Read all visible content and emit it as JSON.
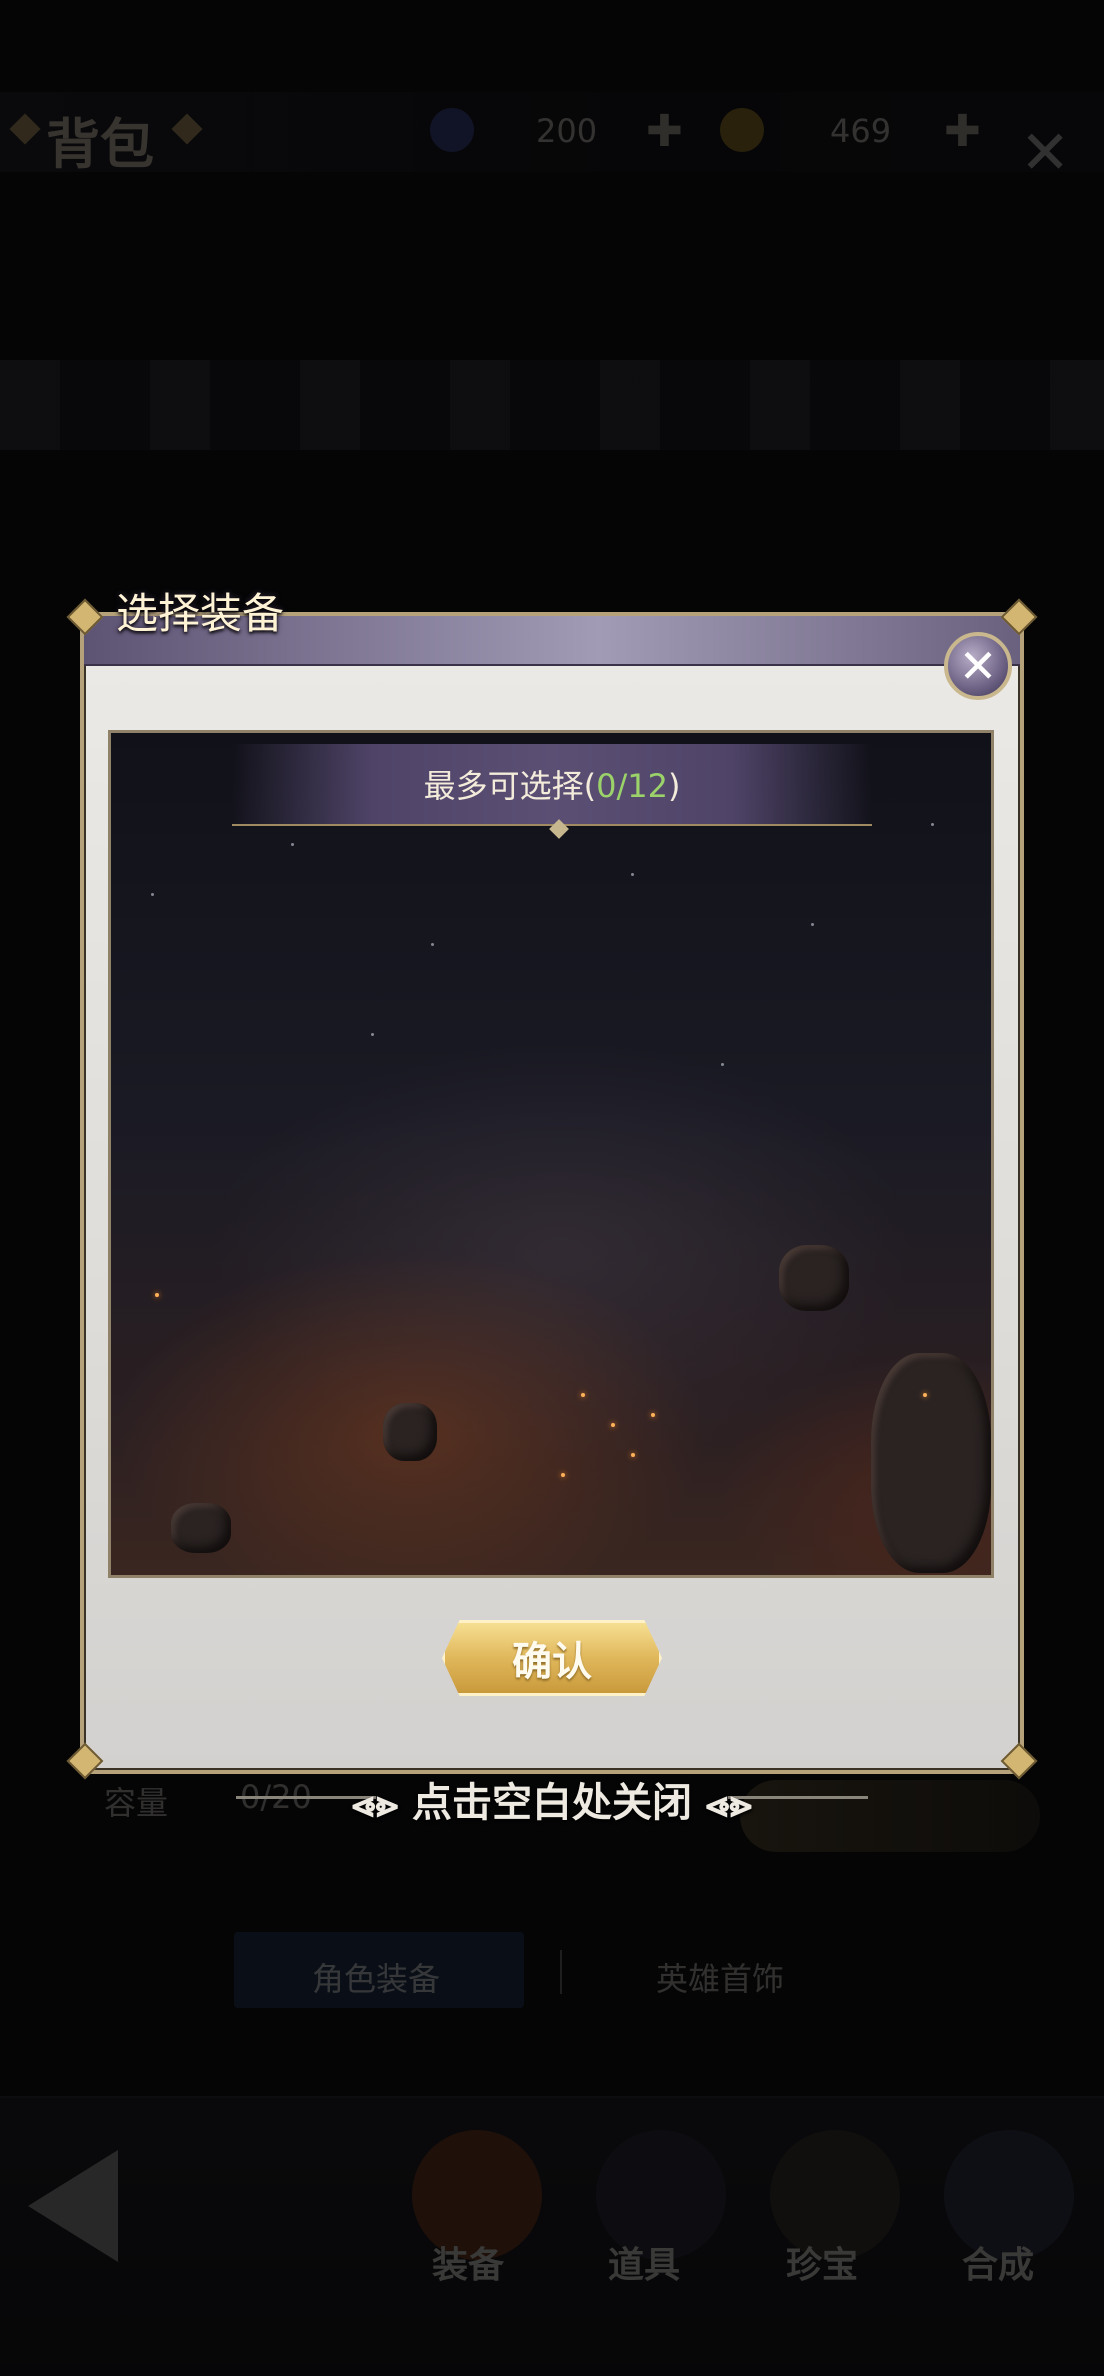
{
  "background": {
    "bag_title": "背包",
    "resource_1_value": "200",
    "resource_2_value": "469",
    "capacity_label": "容量",
    "capacity_value": "0/20",
    "tabs": [
      "角色装备",
      "英雄首饰"
    ],
    "bottom_nav": [
      "装备",
      "道具",
      "珍宝",
      "合成"
    ]
  },
  "modal": {
    "title": "选择装备",
    "selection_text": "最多可选择(",
    "selection_count": "0/12",
    "selection_suffix": ")",
    "confirm_label": "确认",
    "close_hint": "点击空白处关闭",
    "hint_decor_left": "⩹⩺",
    "hint_decor_right": "⩹⩺"
  },
  "colors": {
    "accent_gold": "#d3b672",
    "count_green": "#9bd36a",
    "header_purple": "#5d5373"
  },
  "icons": {
    "close": "close-icon",
    "back": "back-arrow-icon",
    "plus": "plus-icon"
  }
}
